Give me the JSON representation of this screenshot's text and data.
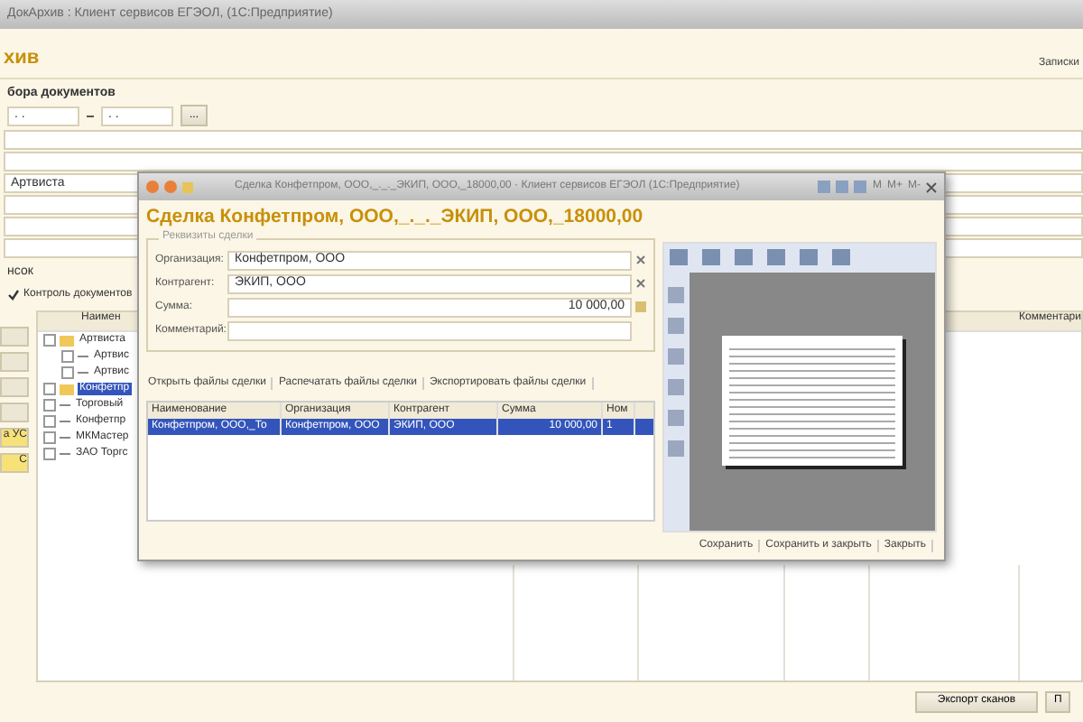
{
  "app_window": {
    "title": "ДокАрхив : Клиент сервисов ЕГЭОЛ, (1С:Предприятие)",
    "heading": "хив",
    "top_right_link": "Записки",
    "filter_label": "бора документов",
    "date_from": ". .",
    "date_to": ". .",
    "pick_button": "...",
    "filter_fields": [
      {
        "kind": "empty"
      },
      {
        "kind": "empty"
      },
      {
        "kind": "text",
        "value": "Артвиста"
      },
      {
        "kind": "empty"
      },
      {
        "kind": "empty"
      },
      {
        "kind": "empty"
      }
    ],
    "section_label": "нсок",
    "control_checkbox": {
      "label": "Контроль документов",
      "checked": true
    },
    "side_buttons": [
      {
        "kind": "plain"
      },
      {
        "kind": "plain"
      },
      {
        "kind": "plain"
      },
      {
        "kind": "plain"
      },
      {
        "kind": "highlighted",
        "label": "а УС"
      },
      {
        "kind": "highlighted",
        "label": "С"
      }
    ],
    "tree": {
      "columns": [
        "Наимен",
        "Комментари"
      ],
      "items": [
        {
          "label": "Артвиста",
          "folder": true,
          "checked": false,
          "selected": false,
          "children": [
            {
              "label": "Артвис",
              "folder": false,
              "checked": false,
              "selected": false
            },
            {
              "label": "Артвис",
              "folder": false,
              "checked": false,
              "selected": false
            }
          ]
        },
        {
          "label": "Конфетпр",
          "folder": true,
          "checked": false,
          "selected": true
        },
        {
          "label": "Торговый",
          "folder": false,
          "checked": false,
          "selected": false
        },
        {
          "label": "Конфетпр",
          "folder": false,
          "checked": false,
          "selected": false
        },
        {
          "label": "МКМастер",
          "folder": false,
          "checked": false,
          "selected": false
        },
        {
          "label": "ЗАО Торгс",
          "folder": false,
          "checked": false,
          "selected": false
        }
      ]
    },
    "footer_buttons": [
      "Экспорт сканов",
      "П"
    ]
  },
  "dialog": {
    "title": "Сделка Конфетпром, ООО,_._._ЭКИП, ООО,_18000,00 · Клиент сервисов ЕГЭОЛ (1С:Предприятие)",
    "title_buttons": [
      "M",
      "M+",
      "M-"
    ],
    "heading": "Сделка Конфетпром, ООО,_._._ЭКИП, ООО,_18000,00",
    "group_title": "Реквизиты сделки",
    "fields": [
      {
        "label": "Организация:",
        "value": "Конфетпром, ООО",
        "kind": "choice"
      },
      {
        "label": "Контрагент:",
        "value": "ЭКИП, ООО",
        "kind": "choice"
      },
      {
        "label": "Сумма:",
        "value": "10 000,00",
        "kind": "number"
      },
      {
        "label": "Комментарий:",
        "kind": "text"
      }
    ],
    "actions": [
      "Открыть файлы сделки",
      "Распечатать файлы сделки",
      "Экспортировать файлы сделки"
    ],
    "table": {
      "columns": [
        "Наименование",
        "Организация",
        "Контрагент",
        "Сумма",
        "Ном"
      ],
      "rows": [
        {
          "cells": [
            "Конфетпром, ООО,_То",
            "Конфетпром, ООО",
            "ЭКИП, ООО",
            "10 000,00",
            "1"
          ],
          "selected": true
        }
      ]
    },
    "bottom_buttons": [
      "Сохранить",
      "Сохранить и закрыть",
      "Закрыть"
    ]
  }
}
